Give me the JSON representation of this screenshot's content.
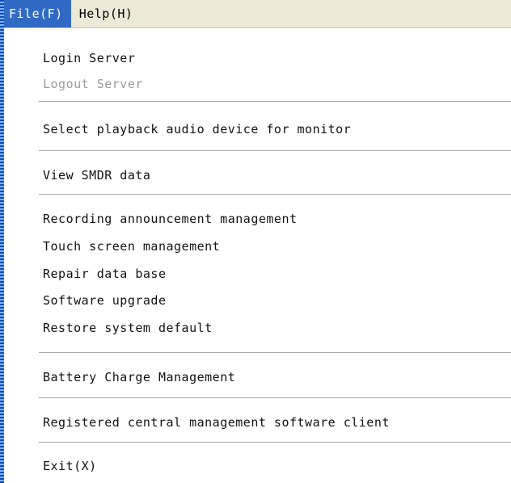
{
  "menubar": {
    "file_label": "File(F)",
    "help_label": "Help(H)"
  },
  "menu": {
    "items": [
      {
        "label": "Login Server",
        "enabled": true
      },
      {
        "label": "Logout Server",
        "enabled": false
      },
      {
        "label": "Select playback audio device for monitor",
        "enabled": true
      },
      {
        "label": "View SMDR data",
        "enabled": true
      },
      {
        "label": "Recording announcement management",
        "enabled": true
      },
      {
        "label": "Touch screen management",
        "enabled": true
      },
      {
        "label": "Repair data base",
        "enabled": true
      },
      {
        "label": "Software upgrade",
        "enabled": true
      },
      {
        "label": "Restore system default",
        "enabled": true
      },
      {
        "label": "Battery Charge Management",
        "enabled": true
      },
      {
        "label": "Registered central management software client",
        "enabled": true
      },
      {
        "label": "Exit(X)",
        "enabled": true
      }
    ]
  },
  "colors": {
    "menubar_bg": "#ece9d8",
    "active_highlight": "#316ac5",
    "disabled_text": "#9a9a9a"
  }
}
